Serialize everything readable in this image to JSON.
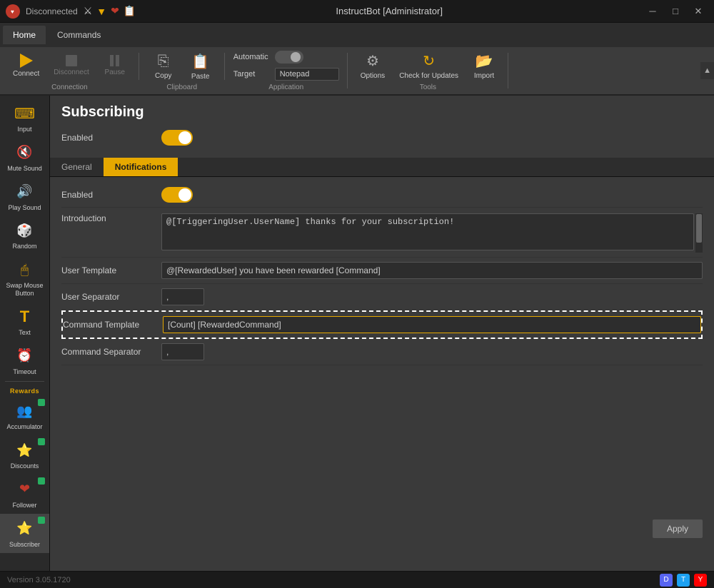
{
  "titlebar": {
    "app_name": "InstructBot [Administrator]",
    "status": "Disconnected",
    "icon_color": "#c0392b"
  },
  "menubar": {
    "tabs": [
      {
        "label": "Home",
        "active": true
      },
      {
        "label": "Commands",
        "active": false
      }
    ]
  },
  "toolbar": {
    "connection": {
      "label": "Connection",
      "connect": "Connect",
      "disconnect": "Disconnect",
      "pause": "Pause"
    },
    "clipboard": {
      "label": "Clipboard",
      "copy": "Copy",
      "paste": "Paste"
    },
    "application": {
      "label": "Application",
      "automatic_label": "Automatic",
      "target_label": "Target",
      "target_value": "Notepad"
    },
    "tools": {
      "label": "Tools",
      "options": "Options",
      "check_for_updates": "Check for Updates",
      "import": "Import"
    }
  },
  "sidebar": {
    "items": [
      {
        "label": "Input",
        "icon": "⌨",
        "active": false,
        "badge": false
      },
      {
        "label": "Mute Sound",
        "icon": "🔇",
        "active": false,
        "badge": false
      },
      {
        "label": "Play Sound",
        "icon": "🔊",
        "active": false,
        "badge": false
      },
      {
        "label": "Random",
        "icon": "🎲",
        "active": false,
        "badge": false
      },
      {
        "label": "Swap Mouse Button",
        "icon": "🖱",
        "active": false,
        "badge": false
      },
      {
        "label": "Text",
        "icon": "T",
        "active": false,
        "badge": false
      },
      {
        "label": "Timeout",
        "icon": "⏰",
        "active": false,
        "badge": false
      }
    ],
    "rewards_section": "Rewards",
    "reward_items": [
      {
        "label": "Accumulator",
        "icon": "👥",
        "active": false,
        "badge": true
      },
      {
        "label": "Discounts",
        "icon": "⭐",
        "active": false,
        "badge": true
      },
      {
        "label": "Follower",
        "icon": "❤",
        "active": false,
        "badge": true
      },
      {
        "label": "Subscriber",
        "icon": "⭐",
        "active": true,
        "badge": true
      }
    ]
  },
  "content": {
    "title": "Subscribing",
    "enabled_label": "Enabled",
    "enabled": true,
    "tabs": [
      {
        "label": "General",
        "active": false
      },
      {
        "label": "Notifications",
        "active": true
      }
    ],
    "notifications": {
      "enabled_label": "Enabled",
      "enabled": true,
      "introduction_label": "Introduction",
      "introduction_value": "@[TriggeringUser.UserName] thanks for your subscription!",
      "user_template_label": "User Template",
      "user_template_value": "@[RewardedUser] you have been rewarded [Command]",
      "user_separator_label": "User Separator",
      "user_separator_value": ",",
      "command_template_label": "Command Template",
      "command_template_value": "[Count] [RewardedCommand]",
      "command_separator_label": "Command Separator",
      "command_separator_value": ","
    }
  },
  "bottombar": {
    "version": "Version 3.05.1720",
    "apply": "Apply"
  }
}
